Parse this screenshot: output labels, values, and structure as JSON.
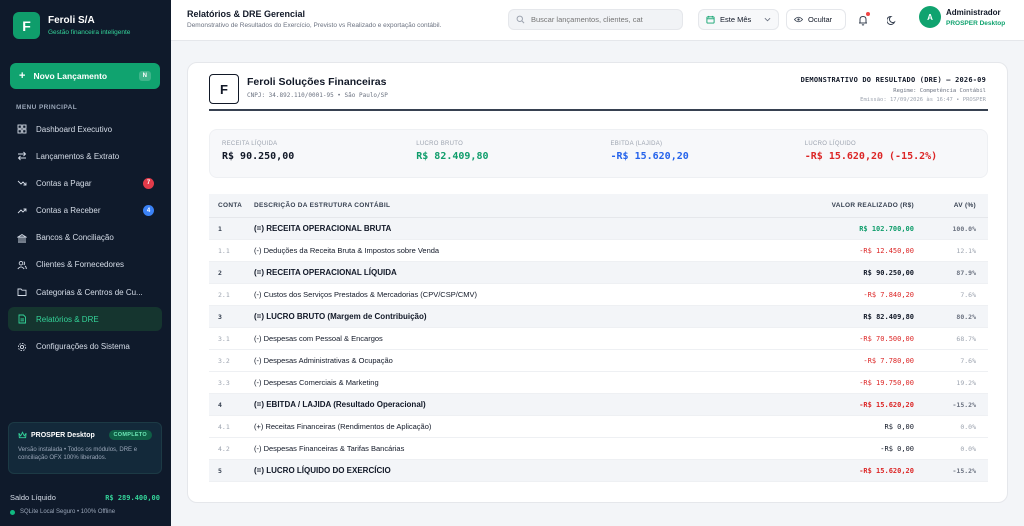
{
  "brand": {
    "logo_letter": "F",
    "name": "Feroli S/A",
    "subtitle": "Gestão financeira inteligente"
  },
  "sidebar": {
    "new_button": {
      "label": "Novo Lançamento",
      "shortcut": "N"
    },
    "menu_title": "MENU PRINCIPAL",
    "items": [
      {
        "label": "Dashboard Executivo",
        "icon": "dashboard-icon"
      },
      {
        "label": "Lançamentos & Extrato",
        "icon": "transfer-icon"
      },
      {
        "label": "Contas a Pagar",
        "icon": "trend-down-icon",
        "badge": "7"
      },
      {
        "label": "Contas a Receber",
        "icon": "trend-up-icon",
        "badge": "4"
      },
      {
        "label": "Bancos & Conciliação",
        "icon": "bank-icon"
      },
      {
        "label": "Clientes & Fornecedores",
        "icon": "users-icon"
      },
      {
        "label": "Categorias & Centros de Cu...",
        "icon": "folder-icon"
      },
      {
        "label": "Relatórios & DRE",
        "icon": "report-icon",
        "active": true
      },
      {
        "label": "Configurações do Sistema",
        "icon": "gear-icon"
      }
    ],
    "promo": {
      "title": "PROSPER Desktop",
      "tag": "COMPLETO",
      "description": "Versão instalada • Todos os módulos, DRE e conciliação OFX 100% liberados."
    },
    "balance": {
      "label": "Saldo Líquido",
      "value": "R$ 289.400,00"
    },
    "status": "SQLite Local Seguro • 100% Offline"
  },
  "topbar": {
    "title": "Relatórios & DRE Gerencial",
    "subtitle": "Demonstrativo de Resultados do Exercício, Previsto vs Realizado e exportação contábil.",
    "search_placeholder": "Buscar lançamentos, clientes, cat",
    "period": "Este Mês",
    "hide_label": "Ocultar",
    "user": {
      "initial": "A",
      "name": "Administrador",
      "role": "PROSPER Desktop"
    }
  },
  "report": {
    "company_letter": "F",
    "company_name": "Feroli Soluções Financeiras",
    "cnpj": "CNPJ: 34.892.110/0001-95 • São Paulo/SP",
    "title": "DEMONSTRATIVO DO RESULTADO (DRE) — 2026-09",
    "regime": "Regime: Competência Contábil",
    "emission": "Emissão: 17/09/2026 às 16:47 • PROSPER",
    "kpis": [
      {
        "label": "RECEITA LÍQUIDA",
        "value": "R$ 90.250,00",
        "color": "#111827"
      },
      {
        "label": "LUCRO BRUTO",
        "value": "R$ 82.409,80",
        "color": "#0f9d6b"
      },
      {
        "label": "EBITDA (LAJIDA)",
        "value": "-R$ 15.620,20",
        "color": "#2563eb"
      },
      {
        "label": "LUCRO LÍQUIDO",
        "value": "-R$ 15.620,20 (-15.2%)",
        "color": "#dc2626"
      }
    ],
    "headers": {
      "code": "CONTA",
      "desc": "DESCRIÇÃO DA ESTRUTURA CONTÁBIL",
      "value": "VALOR REALIZADO (R$)",
      "av": "AV (%)"
    },
    "rows": [
      {
        "code": "1",
        "desc": "(=) RECEITA OPERACIONAL BRUTA",
        "value": "R$ 102.700,00",
        "av": "100.0%",
        "strong": true,
        "color": "#0f9d6b"
      },
      {
        "code": "1.1",
        "desc": "(-) Deduções da Receita Bruta & Impostos sobre Venda",
        "value": "-R$ 12.450,00",
        "av": "12.1%",
        "strong": false,
        "color": "#dc2626"
      },
      {
        "code": "2",
        "desc": "(=) RECEITA OPERACIONAL LÍQUIDA",
        "value": "R$ 90.250,00",
        "av": "87.9%",
        "strong": true,
        "color": "#111827"
      },
      {
        "code": "2.1",
        "desc": "(-) Custos dos Serviços Prestados & Mercadorias (CPV/CSP/CMV)",
        "value": "-R$ 7.840,20",
        "av": "7.6%",
        "strong": false,
        "color": "#dc2626"
      },
      {
        "code": "3",
        "desc": "(=) LUCRO BRUTO (Margem de Contribuição)",
        "value": "R$ 82.409,80",
        "av": "80.2%",
        "strong": true,
        "color": "#111827"
      },
      {
        "code": "3.1",
        "desc": "(-) Despesas com Pessoal & Encargos",
        "value": "-R$ 70.500,00",
        "av": "68.7%",
        "strong": false,
        "color": "#dc2626"
      },
      {
        "code": "3.2",
        "desc": "(-) Despesas Administrativas & Ocupação",
        "value": "-R$ 7.780,00",
        "av": "7.6%",
        "strong": false,
        "color": "#dc2626"
      },
      {
        "code": "3.3",
        "desc": "(-) Despesas Comerciais & Marketing",
        "value": "-R$ 19.750,00",
        "av": "19.2%",
        "strong": false,
        "color": "#dc2626"
      },
      {
        "code": "4",
        "desc": "(=) EBITDA / LAJIDA (Resultado Operacional)",
        "value": "-R$ 15.620,20",
        "av": "-15.2%",
        "strong": true,
        "color": "#dc2626"
      },
      {
        "code": "4.1",
        "desc": "(+) Receitas Financeiras (Rendimentos de Aplicação)",
        "value": "R$ 0,00",
        "av": "0.0%",
        "strong": false,
        "color": "#111827"
      },
      {
        "code": "4.2",
        "desc": "(-) Despesas Financeiras & Tarifas Bancárias",
        "value": "-R$ 0,00",
        "av": "0.0%",
        "strong": false,
        "color": "#111827"
      },
      {
        "code": "5",
        "desc": "(=) LUCRO LÍQUIDO DO EXERCÍCIO",
        "value": "-R$ 15.620,20",
        "av": "-15.2%",
        "strong": true,
        "color": "#dc2626"
      }
    ]
  }
}
